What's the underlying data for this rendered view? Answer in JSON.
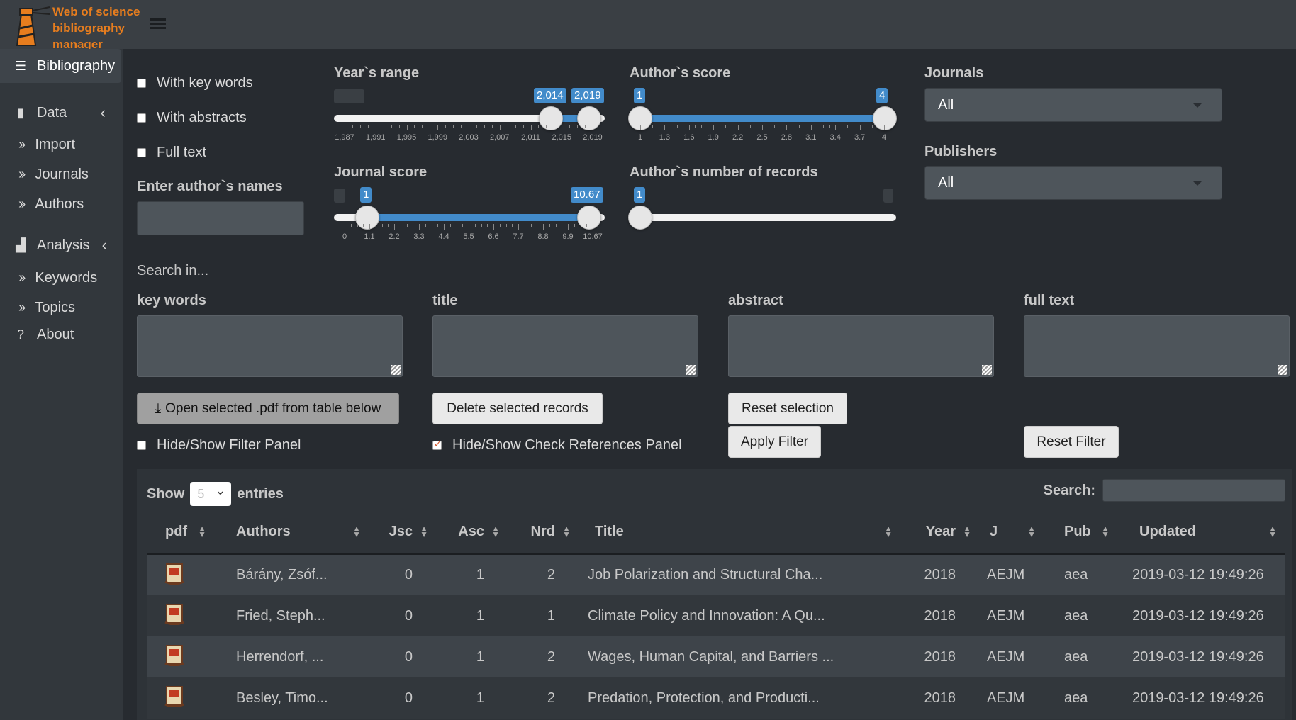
{
  "app": {
    "title": "Web of science bibliography manager"
  },
  "sidebar": {
    "items": [
      {
        "label": "Bibliography",
        "icon": "database-icon"
      },
      {
        "label": "Data",
        "icon": "book-icon"
      },
      {
        "label": "Import"
      },
      {
        "label": "Journals"
      },
      {
        "label": "Authors"
      },
      {
        "label": "Analysis",
        "icon": "bar-chart-icon"
      },
      {
        "label": "Keywords"
      },
      {
        "label": "Topics"
      },
      {
        "label": "About",
        "icon": "question-circle-icon"
      }
    ]
  },
  "filters": {
    "with_keywords": "With key words",
    "with_abstracts": "With abstracts",
    "full_text": "Full text",
    "author_names_label": "Enter author`s names",
    "search_in": "Search in...",
    "keywords_label": "key words",
    "title_label": "title",
    "abstract_label": "abstract",
    "fulltext_label": "full text"
  },
  "sliders": {
    "year_range": {
      "label": "Year`s range",
      "from": "2,014",
      "to": "2,019",
      "ticks": [
        "1,987",
        "1,991",
        "1,995",
        "1,999",
        "2,003",
        "2,007",
        "2,011",
        "2,015",
        "2,019"
      ]
    },
    "author_score": {
      "label": "Author`s score",
      "from": "1",
      "to": "4",
      "ticks": [
        "1",
        "1.3",
        "1.6",
        "1.9",
        "2.2",
        "2.5",
        "2.8",
        "3.1",
        "3.4",
        "3.7",
        "4"
      ]
    },
    "journal_score": {
      "label": "Journal score",
      "from": "1",
      "to": "10.67",
      "ticks": [
        "0",
        "1.1",
        "2.2",
        "3.3",
        "4.4",
        "5.5",
        "6.6",
        "7.7",
        "8.8",
        "9.9",
        "10.67"
      ]
    },
    "author_records": {
      "label": "Author`s number of records",
      "from": "1"
    }
  },
  "selects": {
    "journals": {
      "label": "Journals",
      "value": "All"
    },
    "publishers": {
      "label": "Publishers",
      "value": "All"
    }
  },
  "buttons": {
    "open_pdf": "Open selected .pdf from table below",
    "delete": "Delete selected records",
    "reset_selection": "Reset selection",
    "apply_filter": "Apply Filter",
    "reset_filter": "Reset Filter"
  },
  "toggles": {
    "filter_panel": "Hide/Show Filter Panel",
    "check_refs": "Hide/Show Check References Panel"
  },
  "table": {
    "show": "Show",
    "entries": "entries",
    "length": "5",
    "search_label": "Search:",
    "columns": [
      "pdf",
      "Authors",
      "Jsc",
      "Asc",
      "Nrd",
      "Title",
      "Year",
      "J",
      "Pub",
      "Updated"
    ],
    "rows": [
      [
        "Bárány, Zsóf...",
        "0",
        "1",
        "2",
        "Job Polarization and Structural Cha...",
        "2018",
        "AEJM",
        "aea",
        "2019-03-12 19:49:26"
      ],
      [
        "Fried, Steph...",
        "0",
        "1",
        "1",
        "Climate Policy and Innovation: A Qu...",
        "2018",
        "AEJM",
        "aea",
        "2019-03-12 19:49:26"
      ],
      [
        "Herrendorf, ...",
        "0",
        "1",
        "2",
        "Wages, Human Capital, and Barriers ...",
        "2018",
        "AEJM",
        "aea",
        "2019-03-12 19:49:26"
      ],
      [
        "Besley, Timo...",
        "0",
        "1",
        "2",
        "Predation, Protection, and Producti...",
        "2018",
        "AEJM",
        "aea",
        "2019-03-12 19:49:26"
      ]
    ]
  }
}
